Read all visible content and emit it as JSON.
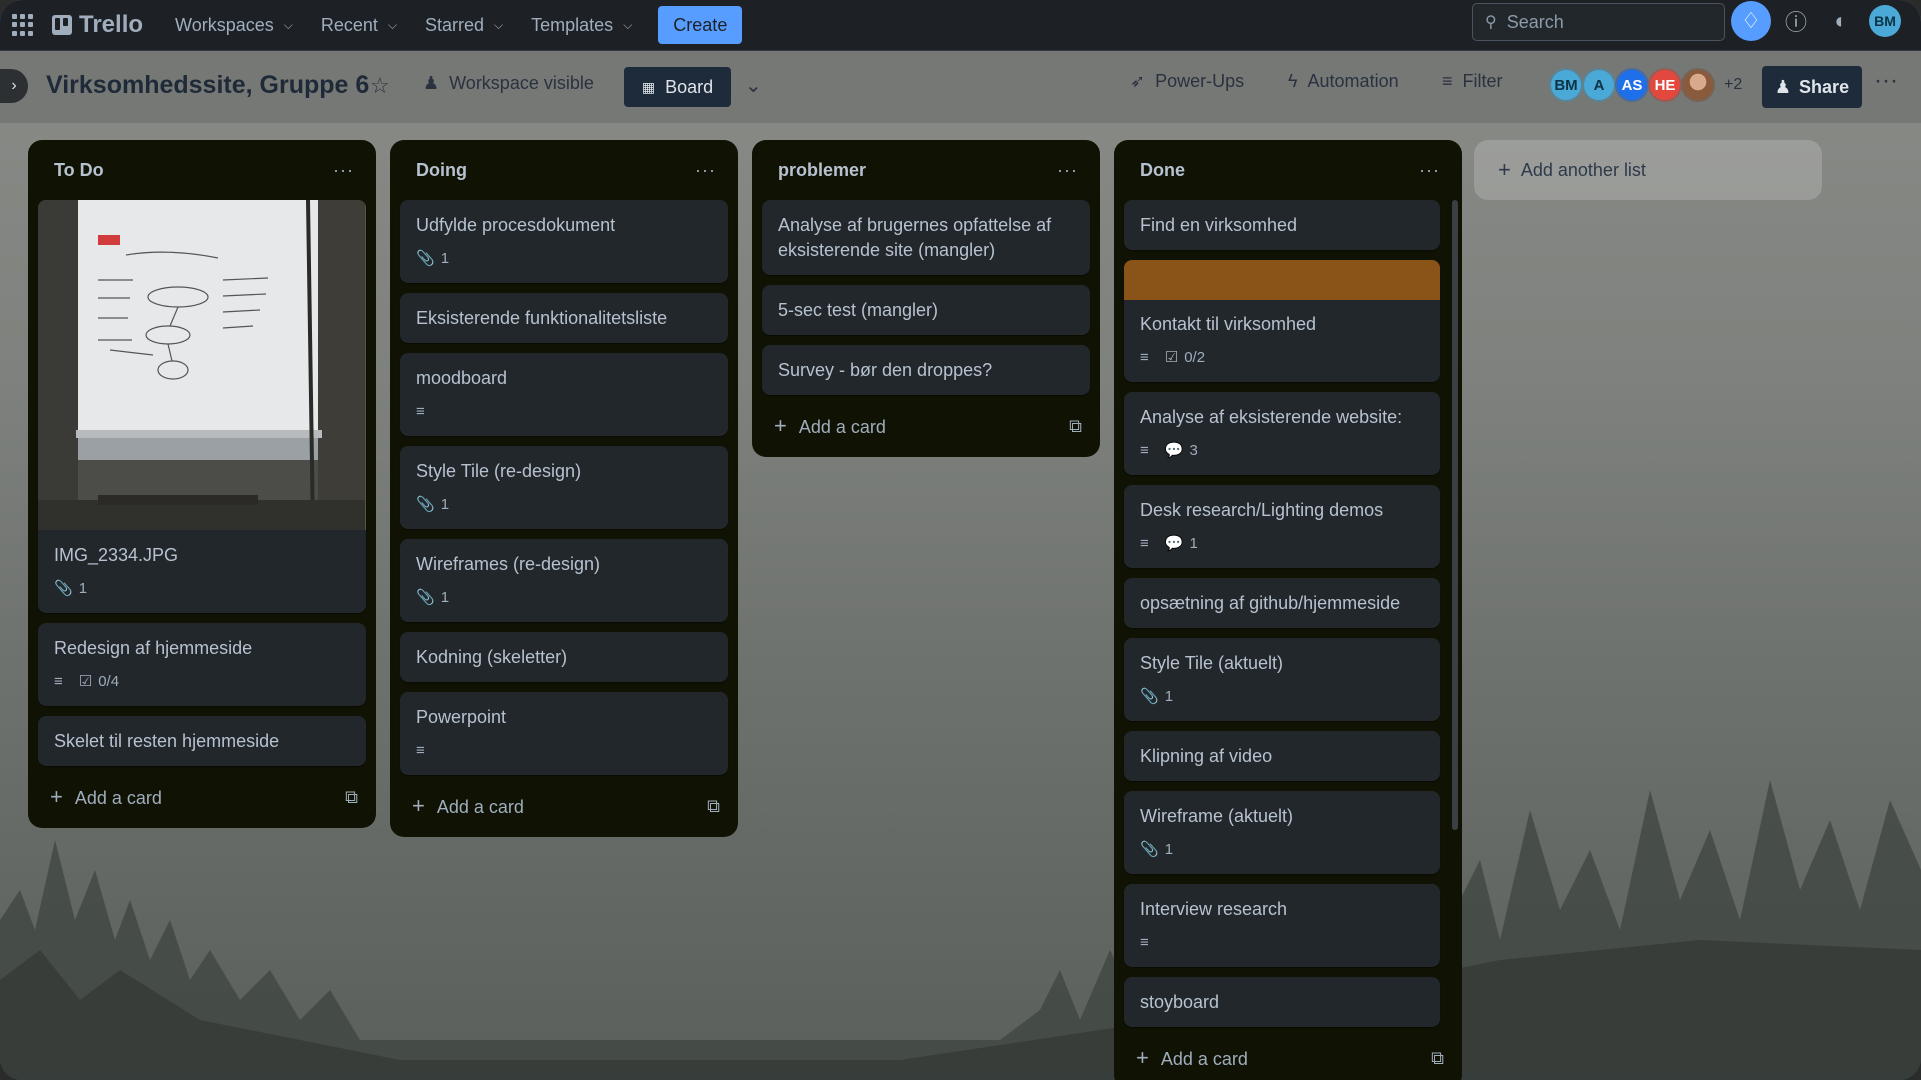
{
  "topbar": {
    "app_name": "Trello",
    "nav": [
      {
        "label": "Workspaces"
      },
      {
        "label": "Recent"
      },
      {
        "label": "Starred"
      },
      {
        "label": "Templates"
      }
    ],
    "create_label": "Create",
    "search_placeholder": "Search",
    "user_initials": "BM"
  },
  "board": {
    "title": "Virksomhedssite, Gruppe 6",
    "visibility": "Workspace visible",
    "view_label": "Board",
    "powerups_label": "Power-Ups",
    "automation_label": "Automation",
    "filter_label": "Filter",
    "members": [
      {
        "initials": "BM",
        "color": "#4aa9d6",
        "text_color": "#0c3346"
      },
      {
        "initials": "A",
        "color": "#4aa9d6",
        "text_color": "#0c3346"
      },
      {
        "initials": "AS",
        "color": "#1f6feb",
        "text_color": "#ffffff"
      },
      {
        "initials": "HE",
        "color": "#e2483d",
        "text_color": "#ffffff"
      },
      {
        "initials": "",
        "color": "#b88a6a",
        "text_color": "#ffffff"
      }
    ],
    "extra_members": "+2",
    "share_label": "Share"
  },
  "lists": [
    {
      "title": "To Do",
      "cards": [
        {
          "title": "IMG_2334.JPG",
          "cover": "image",
          "attachments": "1"
        },
        {
          "title": "Redesign af hjemmeside",
          "description": true,
          "checklist": "0/4"
        },
        {
          "title": "Skelet til resten hjemmeside"
        }
      ],
      "add_label": "Add a card"
    },
    {
      "title": "Doing",
      "cards": [
        {
          "title": "Udfylde procesdokument",
          "attachments": "1"
        },
        {
          "title": "Eksisterende funktionalitetsliste"
        },
        {
          "title": "moodboard",
          "description": true
        },
        {
          "title": "Style Tile (re-design)",
          "attachments": "1"
        },
        {
          "title": "Wireframes (re-design)",
          "attachments": "1"
        },
        {
          "title": "Kodning (skeletter)"
        },
        {
          "title": "Powerpoint",
          "description": true
        }
      ],
      "add_label": "Add a card"
    },
    {
      "title": "problemer",
      "cards": [
        {
          "title": "Analyse af brugernes opfattelse af eksisterende site (mangler)"
        },
        {
          "title": "5-sec test (mangler)"
        },
        {
          "title": "Survey - bør den droppes?"
        }
      ],
      "add_label": "Add a card"
    },
    {
      "title": "Done",
      "cards": [
        {
          "title": "Find en virksomhed"
        },
        {
          "title": "Kontakt til virksomhed",
          "cover": "color",
          "cover_color": "#8a5318",
          "description": true,
          "checklist": "0/2"
        },
        {
          "title": "Analyse af eksisterende website:",
          "description": true,
          "comments": "3"
        },
        {
          "title": "Desk research/Lighting demos",
          "description": true,
          "comments": "1"
        },
        {
          "title": "opsætning af github/hjemmeside"
        },
        {
          "title": "Style Tile (aktuelt)",
          "attachments": "1"
        },
        {
          "title": "Klipning af video"
        },
        {
          "title": "Wireframe (aktuelt)",
          "attachments": "1"
        },
        {
          "title": "Interview research",
          "description": true
        },
        {
          "title": "stoyboard"
        }
      ],
      "add_label": "Add a card"
    }
  ],
  "add_list_label": "Add another list"
}
